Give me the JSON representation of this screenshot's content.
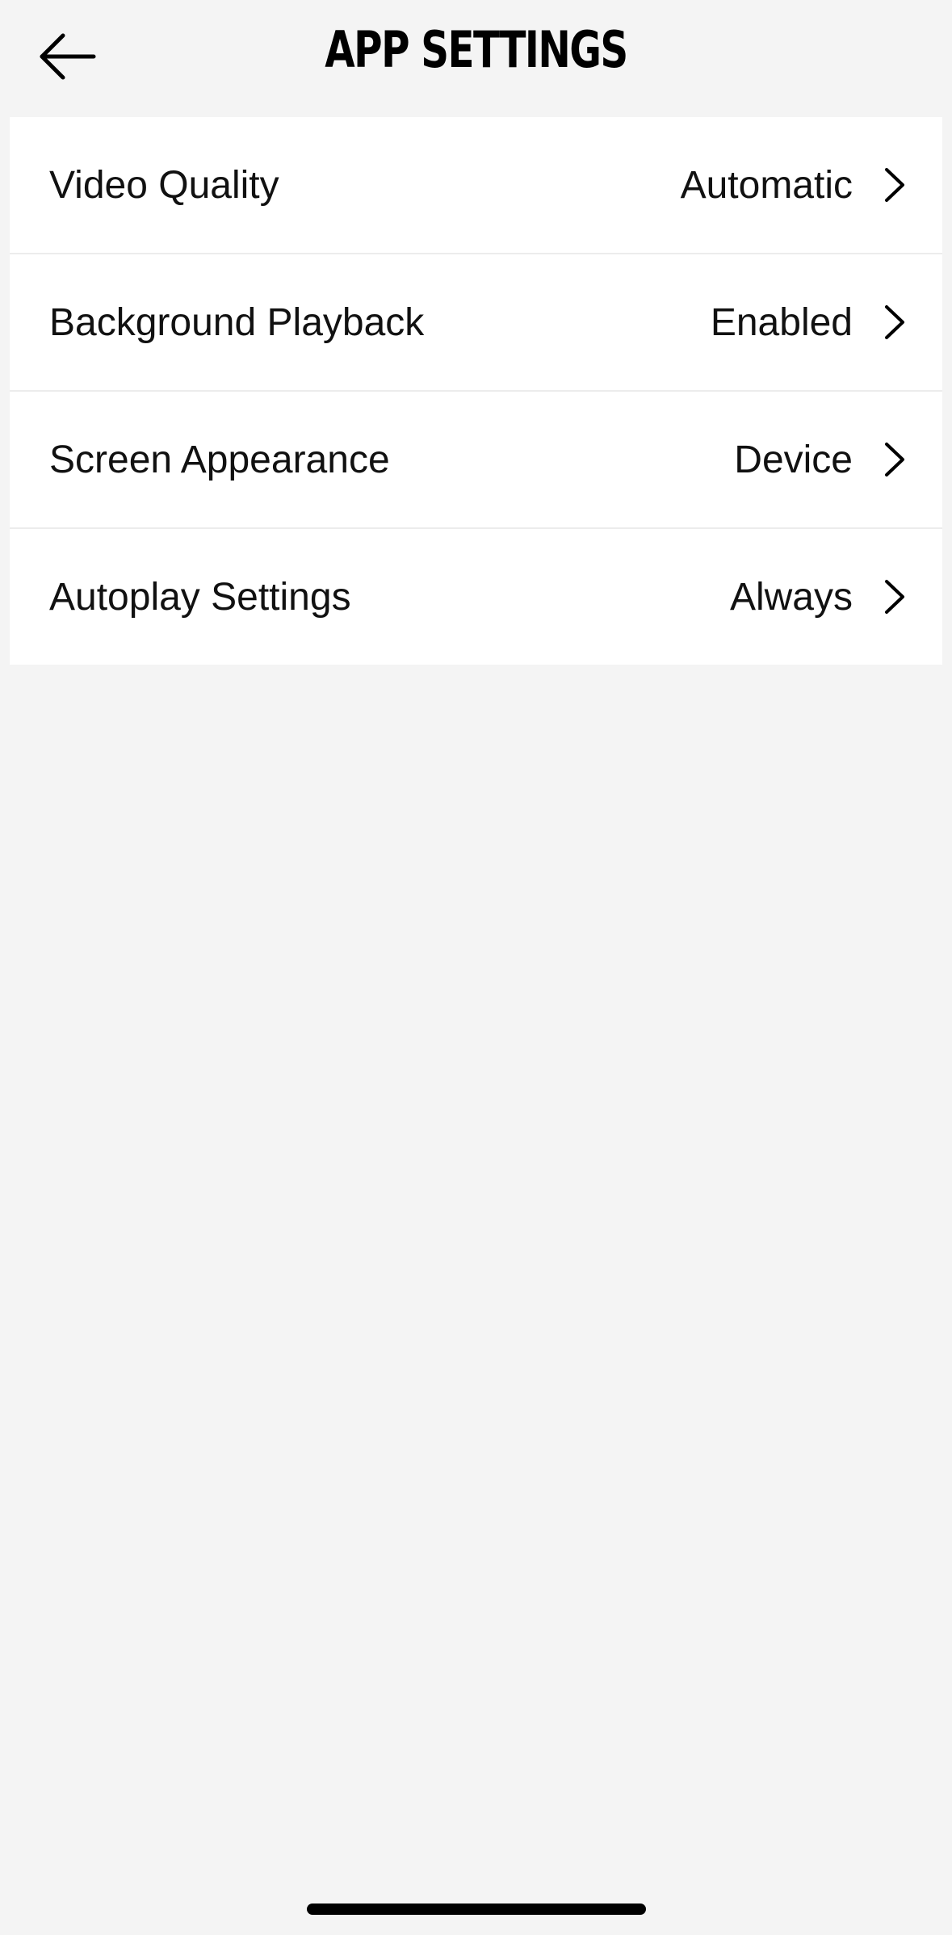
{
  "header": {
    "title": "APP SETTINGS",
    "back_icon": "arrow-left-icon"
  },
  "settings": [
    {
      "label": "Video Quality",
      "value": "Automatic",
      "icon": "chevron-right-icon"
    },
    {
      "label": "Background Playback",
      "value": "Enabled",
      "icon": "chevron-right-icon"
    },
    {
      "label": "Screen Appearance",
      "value": "Device",
      "icon": "chevron-right-icon"
    },
    {
      "label": "Autoplay Settings",
      "value": "Always",
      "icon": "chevron-right-icon"
    }
  ],
  "colors": {
    "background": "#f4f4f4",
    "card": "#ffffff",
    "text": "#111111",
    "divider": "#ececec"
  }
}
